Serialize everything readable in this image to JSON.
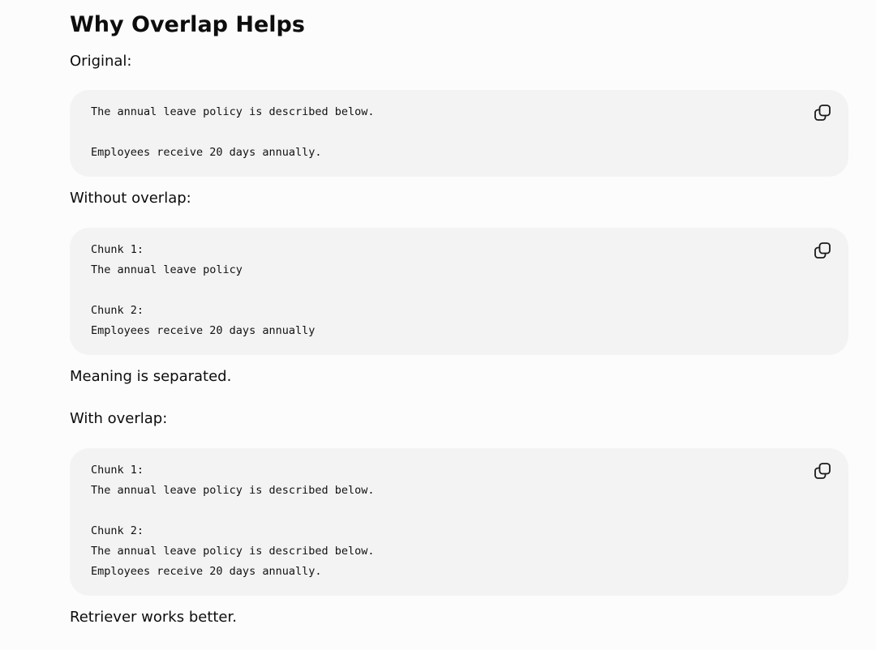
{
  "heading": "Why Overlap Helps",
  "labels": {
    "original": "Original:",
    "without_overlap": "Without overlap:",
    "meaning_separated": "Meaning is separated.",
    "with_overlap": "With overlap:",
    "retriever_better": "Retriever works better."
  },
  "code_blocks": {
    "original": {
      "lines": [
        "The annual leave policy is described below.",
        "",
        "Employees receive 20 days annually."
      ]
    },
    "without_overlap": {
      "lines": [
        "Chunk 1:",
        "The annual leave policy",
        "",
        "Chunk 2:",
        "Employees receive 20 days annually"
      ]
    },
    "with_overlap": {
      "lines": [
        "Chunk 1:",
        "The annual leave policy is described below.",
        "",
        "Chunk 2:",
        "The annual leave policy is described below.",
        "Employees receive 20 days annually."
      ]
    }
  },
  "icons": {
    "copy": "copy-icon"
  }
}
